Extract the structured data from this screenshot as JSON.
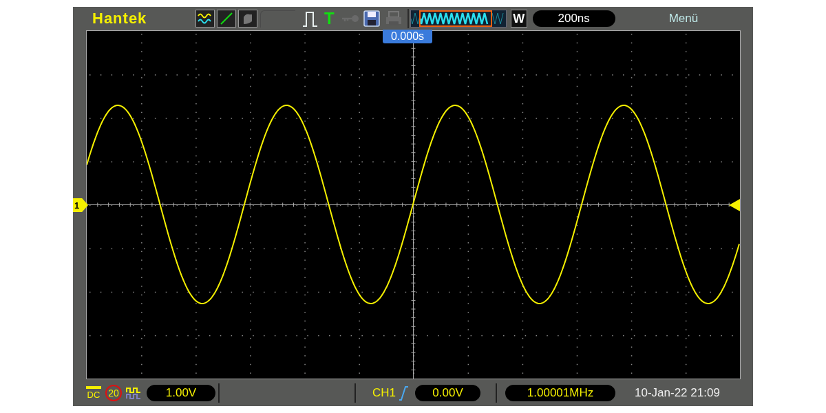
{
  "brand": "Hantek",
  "top_bar": {
    "trigger_type": "T",
    "zoom_label": "W",
    "timebase": "200ns",
    "menu": "Menü"
  },
  "screen": {
    "trigger_position": "0.000s",
    "channel_marker": "1"
  },
  "bottom_bar": {
    "coupling": "DC",
    "bandwidth_limit": "20",
    "volts_per_div": "1.00V",
    "trigger_source": "CH1",
    "trigger_level": "0.00V",
    "frequency": "1.00001MHz",
    "datetime": "10-Jan-22 21:09"
  }
}
